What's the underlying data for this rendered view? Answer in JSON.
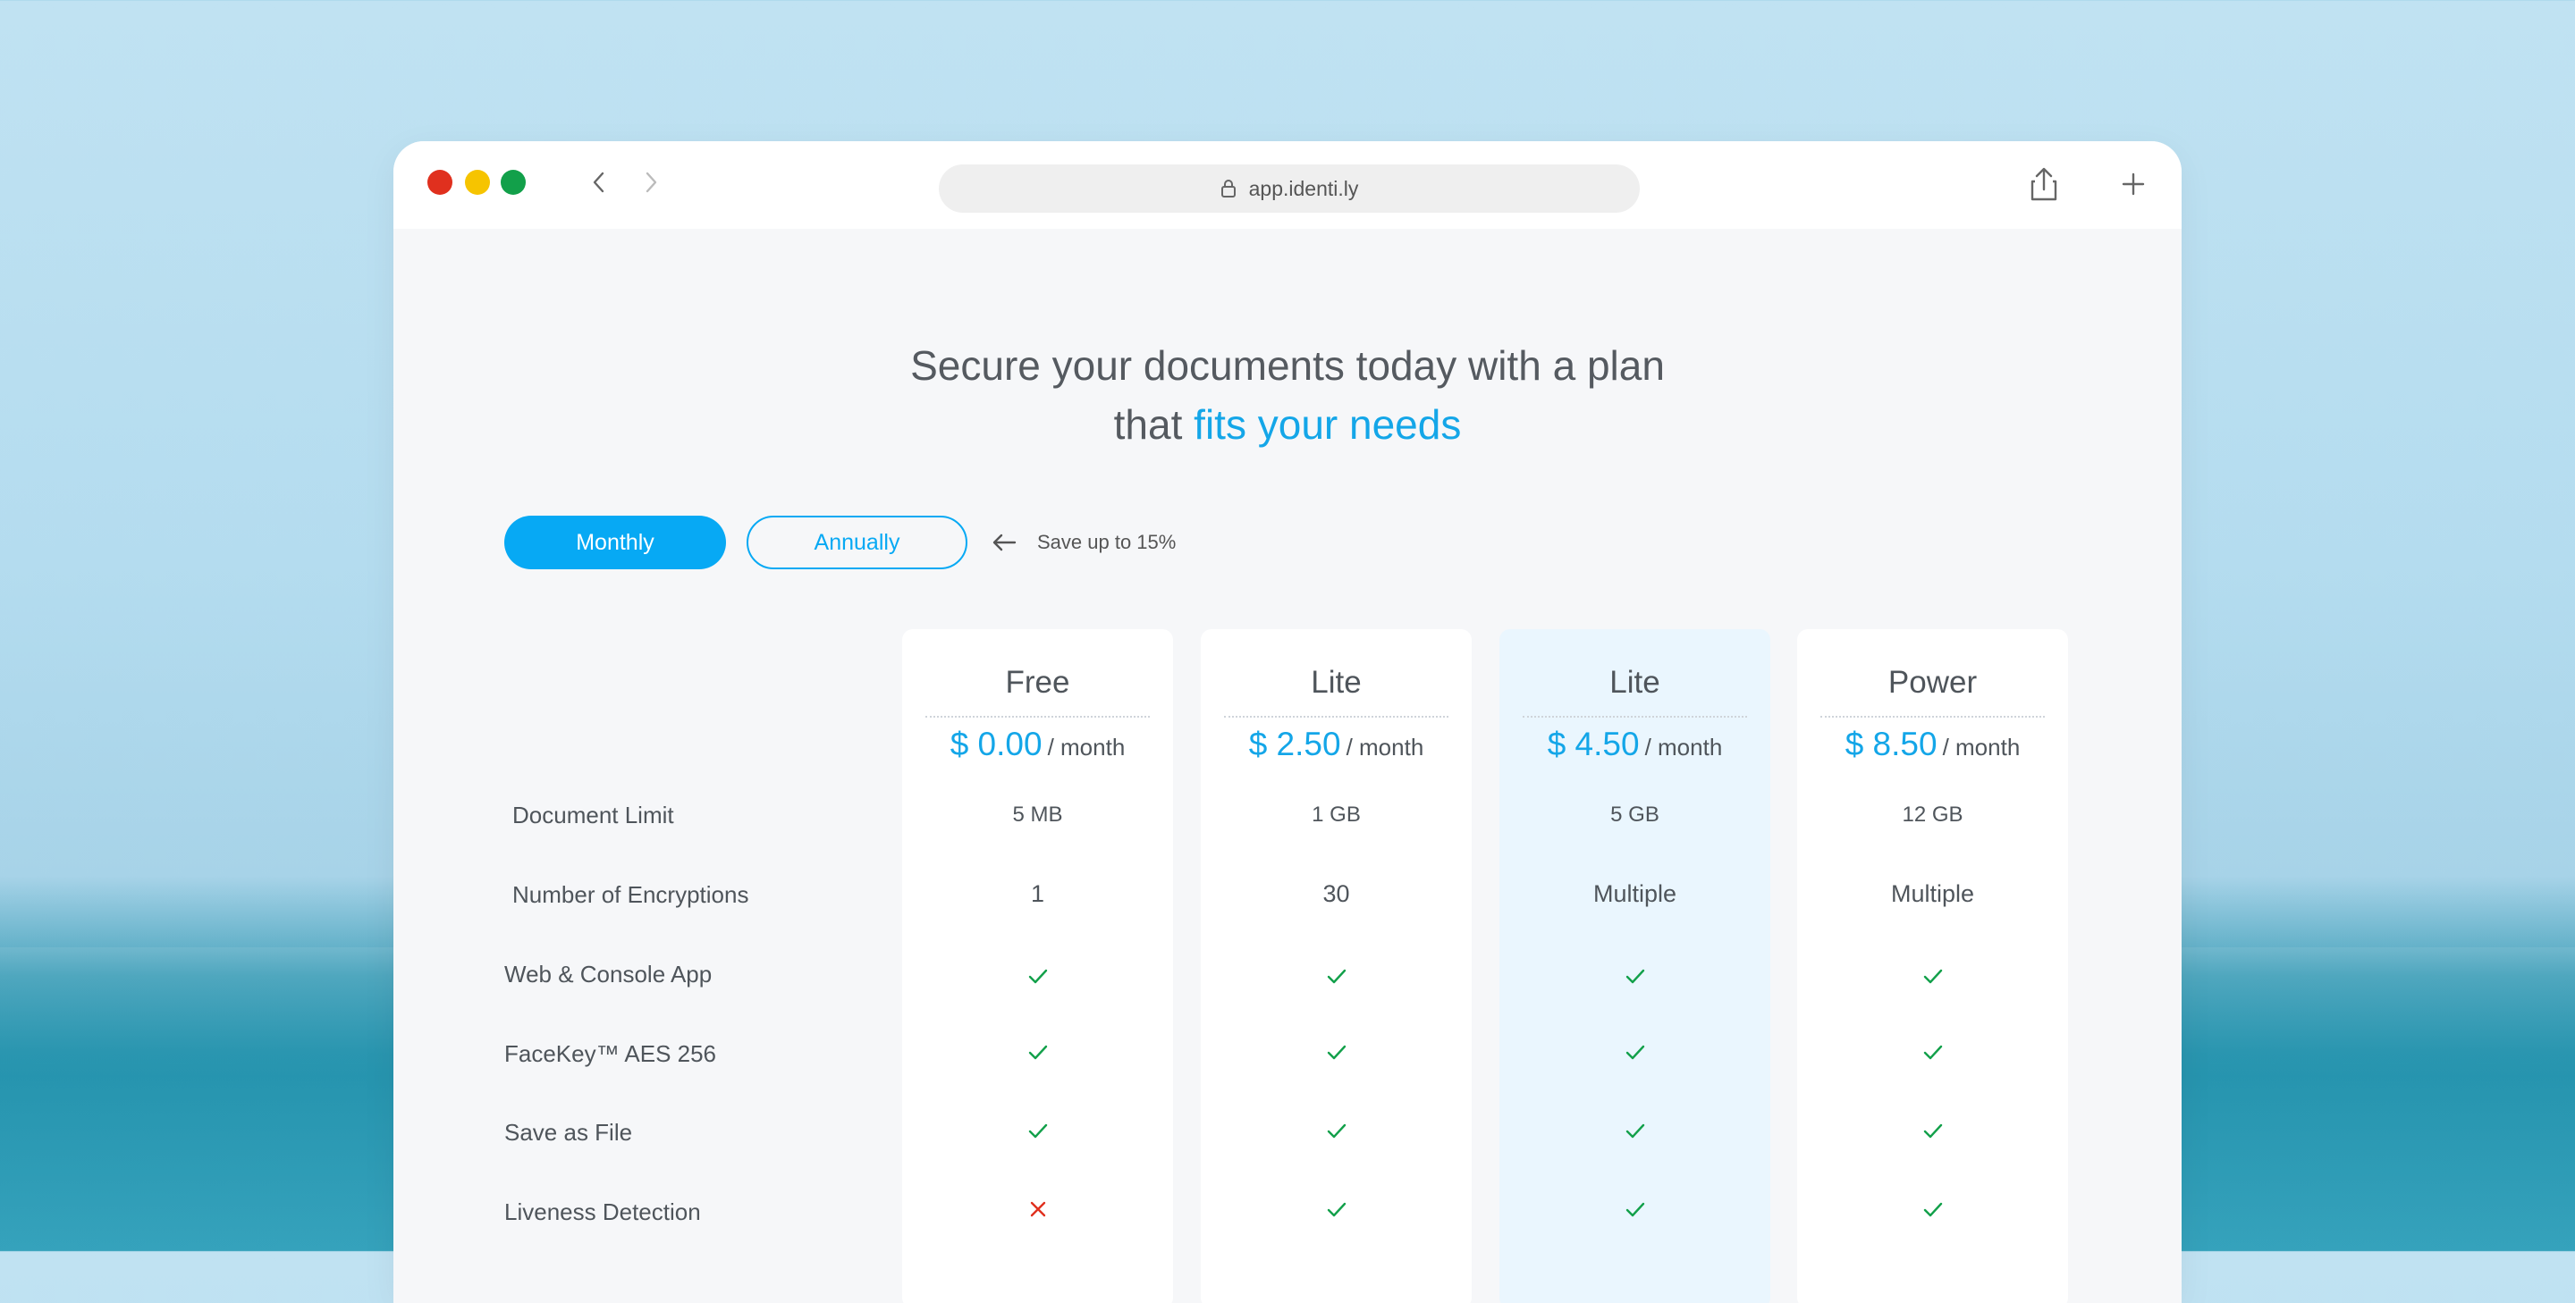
{
  "browser": {
    "url": "app.identi.ly"
  },
  "headline": {
    "line1": "Secure your documents today with a plan",
    "line2_prefix": "that",
    "line2_accent": "fits your needs"
  },
  "billing": {
    "monthly_label": "Monthly",
    "annually_label": "Annually",
    "save_note": "Save up to 15%",
    "selected": "Monthly"
  },
  "colors": {
    "accent": "#07a9f4",
    "check": "#12a04a",
    "cross": "#e0301e",
    "highlight_column": "#eaf6fe"
  },
  "features": [
    "Document Limit",
    "Number of Encryptions",
    "Web & Console App",
    "FaceKey™ AES 256",
    "Save as File",
    "Liveness Detection"
  ],
  "plans": [
    {
      "name": "Free",
      "price": "$ 0.00",
      "period": "/ month",
      "document_limit": "5 MB",
      "encryptions": "1",
      "web_console": "check",
      "facekey": "check",
      "save_file": "check",
      "liveness": "cross",
      "highlighted": false
    },
    {
      "name": "Lite",
      "price": "$ 2.50",
      "period": "/ month",
      "document_limit": "1 GB",
      "encryptions": "30",
      "web_console": "check",
      "facekey": "check",
      "save_file": "check",
      "liveness": "check",
      "highlighted": false
    },
    {
      "name": "Lite",
      "price": "$ 4.50",
      "period": "/ month",
      "document_limit": "5 GB",
      "encryptions": "Multiple",
      "web_console": "check",
      "facekey": "check",
      "save_file": "check",
      "liveness": "check",
      "highlighted": true
    },
    {
      "name": "Power",
      "price": "$ 8.50",
      "period": "/ month",
      "document_limit": "12 GB",
      "encryptions": "Multiple",
      "web_console": "check",
      "facekey": "check",
      "save_file": "check",
      "liveness": "check",
      "highlighted": false
    }
  ]
}
